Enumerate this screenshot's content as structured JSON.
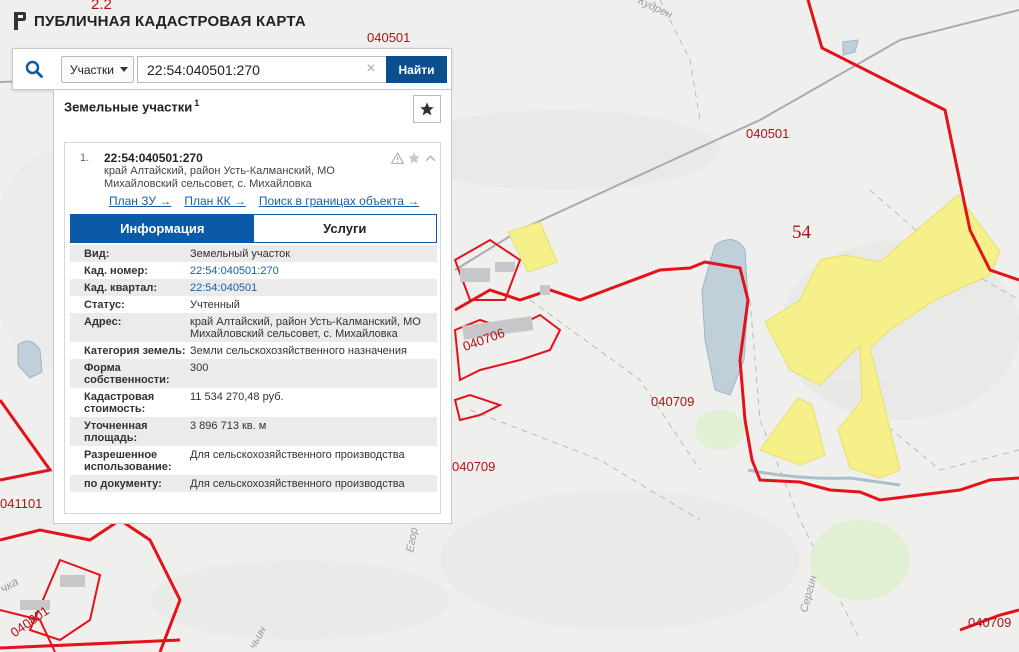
{
  "app": {
    "title": "ПУБЛИЧНАЯ КАДАСТРОВАЯ КАРТА"
  },
  "search": {
    "type_label": "Участки",
    "query": "22:54:040501:270",
    "find_label": "Найти"
  },
  "results": {
    "header": "Земельные участки",
    "count": "1",
    "item": {
      "number": "1.",
      "cad_number": "22:54:040501:270",
      "address": "край Алтайский, район Усть-Калманский, МО Михайловский сельсовет, с. Михайловка",
      "links": [
        "План ЗУ →",
        "План КК →",
        "Поиск в границах объекта →"
      ]
    },
    "tabs": [
      "Информация",
      "Услуги"
    ],
    "info": [
      {
        "k": "Вид:",
        "v": "Земельный участок"
      },
      {
        "k": "Кад. номер:",
        "v": "22:54:040501:270",
        "link": true
      },
      {
        "k": "Кад. квартал:",
        "v": "22:54:040501",
        "link": true
      },
      {
        "k": "Статус:",
        "v": "Учтенный"
      },
      {
        "k": "Адрес:",
        "v": "край Алтайский, район Усть-Калманский, МО Михайловский сельсовет, с. Михайловка"
      },
      {
        "k": "Категория земель:",
        "v": "Земли сельскохозяйственного назначения"
      },
      {
        "k": "Форма собственности:",
        "v": "300"
      },
      {
        "k": "Кадастровая стоимость:",
        "v": "11 534 270,48 руб."
      },
      {
        "k": "Уточненная площадь:",
        "v": "3 896 713 кв. м"
      },
      {
        "k": "Разрешенное использование:",
        "v": "Для сельскохозяйственного производства"
      },
      {
        "k": "по документу:",
        "v": "Для сельскохозяйственного производства"
      }
    ]
  },
  "map_labels": {
    "l1": "2.2",
    "l2": "040501",
    "l3": "Кудрен",
    "l4": "040501",
    "l5": "54",
    "l6": "040706",
    "l7": "040709",
    "l8": "040709",
    "l9": "041101",
    "l10": "Егор",
    "l11": "040801",
    "l12": "чка",
    "l13": "Сергин",
    "l14": "чьин",
    "l15": "040709"
  },
  "colors": {
    "accent": "#0b5aa8",
    "boundary": "#e3121b",
    "parcel": "#f5f08a",
    "water": "#bfd0da"
  }
}
